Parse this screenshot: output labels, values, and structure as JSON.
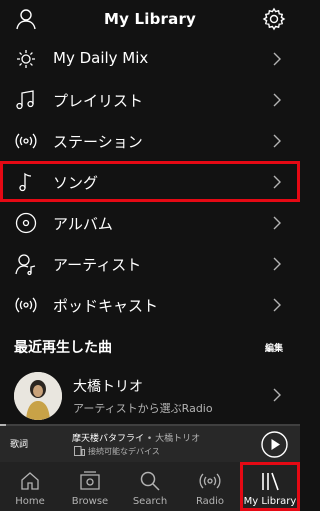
{
  "header": {
    "title": "My Library",
    "profile_icon": "user-icon",
    "settings_icon": "gear-icon"
  },
  "menu": [
    {
      "label": "My Daily Mix",
      "icon": "sun-icon",
      "highlighted": false
    },
    {
      "label": "プレイリスト",
      "icon": "music-notes-icon",
      "highlighted": false
    },
    {
      "label": "ステーション",
      "icon": "radio-waves-icon",
      "highlighted": false
    },
    {
      "label": "ソング",
      "icon": "music-note-icon",
      "highlighted": true
    },
    {
      "label": "アルバム",
      "icon": "disc-icon",
      "highlighted": false
    },
    {
      "label": "アーティスト",
      "icon": "artist-icon",
      "highlighted": false
    },
    {
      "label": "ポッドキャスト",
      "icon": "podcast-icon",
      "highlighted": false
    }
  ],
  "recent": {
    "title": "最近再生した曲",
    "edit_label": "編集",
    "items": [
      {
        "name": "大橋トリオ",
        "subtitle": "アーティストから選ぶRadio"
      }
    ]
  },
  "now_playing": {
    "lyrics_label": "歌詞",
    "track": "摩天楼バタフライ",
    "separator": "•",
    "artist": "大橋トリオ",
    "device": "接続可能なデバイス",
    "progress": 0.02
  },
  "tabs": [
    {
      "label": "Home",
      "icon": "home-icon",
      "active": false
    },
    {
      "label": "Browse",
      "icon": "browse-icon",
      "active": false
    },
    {
      "label": "Search",
      "icon": "search-icon",
      "active": false
    },
    {
      "label": "Radio",
      "icon": "radio-icon",
      "active": false
    },
    {
      "label": "My Library",
      "icon": "library-icon",
      "active": true
    }
  ],
  "colors": {
    "background": "#121212",
    "highlight": "#e50914",
    "text_secondary": "#b3b3b3"
  }
}
